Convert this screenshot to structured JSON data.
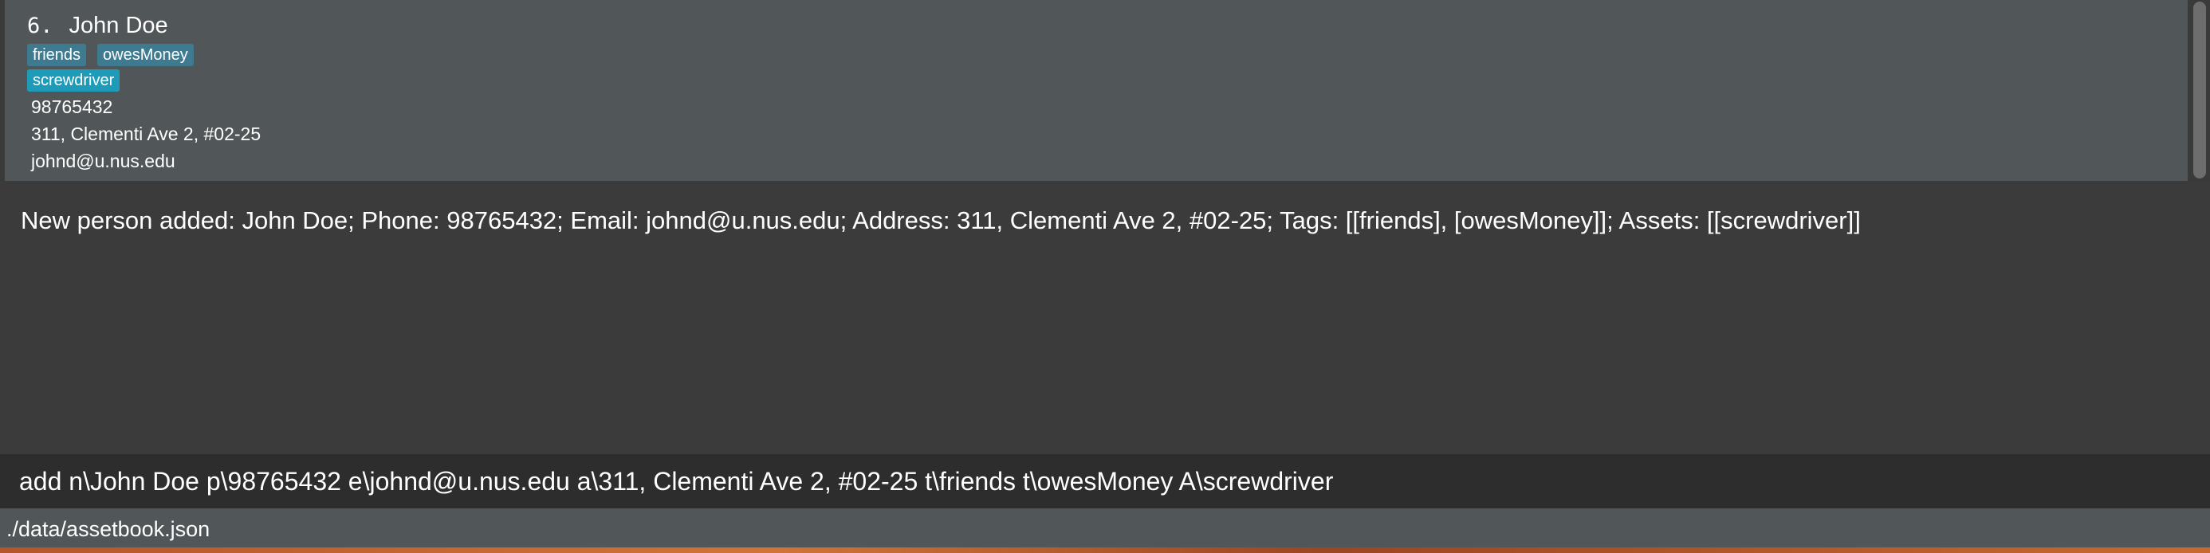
{
  "person_list": {
    "person": {
      "index": "6.",
      "name": "John Doe",
      "tags": [
        "friends",
        "owesMoney"
      ],
      "assets": [
        "screwdriver"
      ],
      "phone": "98765432",
      "address": "311, Clementi Ave 2, #02-25",
      "email": "johnd@u.nus.edu"
    }
  },
  "result_display": {
    "message": "New person added: John Doe; Phone: 98765432; Email: johnd@u.nus.edu; Address: 311, Clementi Ave 2, #02-25; Tags: [[friends], [owesMoney]]; Assets: [[screwdriver]]"
  },
  "command_box": {
    "value": "add n\\John Doe p\\98765432 e\\johnd@u.nus.edu a\\311, Clementi Ave 2, #02-25 t\\friends t\\owesMoney A\\screwdriver"
  },
  "status_bar": {
    "save_location": "./data/assetbook.json"
  },
  "colors": {
    "window_background": "#3b3b3b",
    "card_background": "#515658",
    "tag_background": "#3e7b91",
    "asset_background": "#1e9bb8",
    "command_background": "#2d2d2d"
  }
}
